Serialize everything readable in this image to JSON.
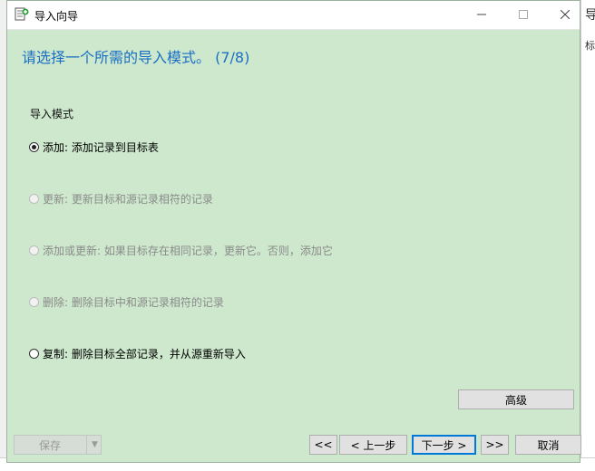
{
  "window": {
    "title": "导入向导"
  },
  "step_title": "请选择一个所需的导入模式。 (7/8)",
  "section_label": "导入模式",
  "options": [
    {
      "label": "添加: 添加记录到目标表",
      "checked": true,
      "enabled": true
    },
    {
      "label": "更新: 更新目标和源记录相符的记录",
      "checked": false,
      "enabled": false
    },
    {
      "label": "添加或更新: 如果目标存在相同记录，更新它。否则，添加它",
      "checked": false,
      "enabled": false
    },
    {
      "label": "删除: 删除目标中和源记录相符的记录",
      "checked": false,
      "enabled": false
    },
    {
      "label": "复制: 删除目标全部记录，并从源重新导入",
      "checked": false,
      "enabled": true
    }
  ],
  "buttons": {
    "advanced": "高级",
    "save": "保存",
    "first": "<<",
    "prev": "< 上一步",
    "next": "下一步 >",
    "last": ">>",
    "cancel": "取消"
  },
  "icons": {
    "app": "import-wizard-icon",
    "minimize": "minimize-icon",
    "maximize": "maximize-icon",
    "close": "close-icon"
  },
  "colors": {
    "dialog_bg": "#cde8cd",
    "step_title": "#1a6fc4",
    "primary_border": "#0078d7"
  },
  "background_fragments": [
    "导",
    "标"
  ]
}
